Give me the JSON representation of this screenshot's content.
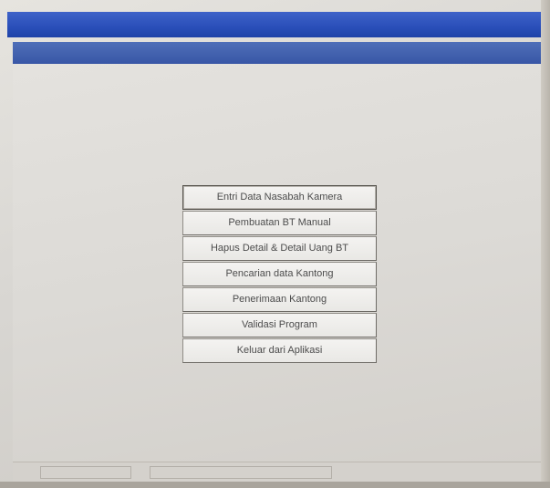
{
  "window": {
    "title": "",
    "subtitle": ""
  },
  "menu": {
    "items": [
      {
        "label": "Entri Data Nasabah Kamera"
      },
      {
        "label": "Pembuatan BT Manual"
      },
      {
        "label": "Hapus Detail & Detail Uang BT"
      },
      {
        "label": "Pencarian data Kantong"
      },
      {
        "label": "Penerimaan Kantong"
      },
      {
        "label": "Validasi Program"
      },
      {
        "label": "Keluar dari Aplikasi"
      }
    ]
  },
  "statusbar": {
    "pane1": "",
    "pane2": ""
  }
}
